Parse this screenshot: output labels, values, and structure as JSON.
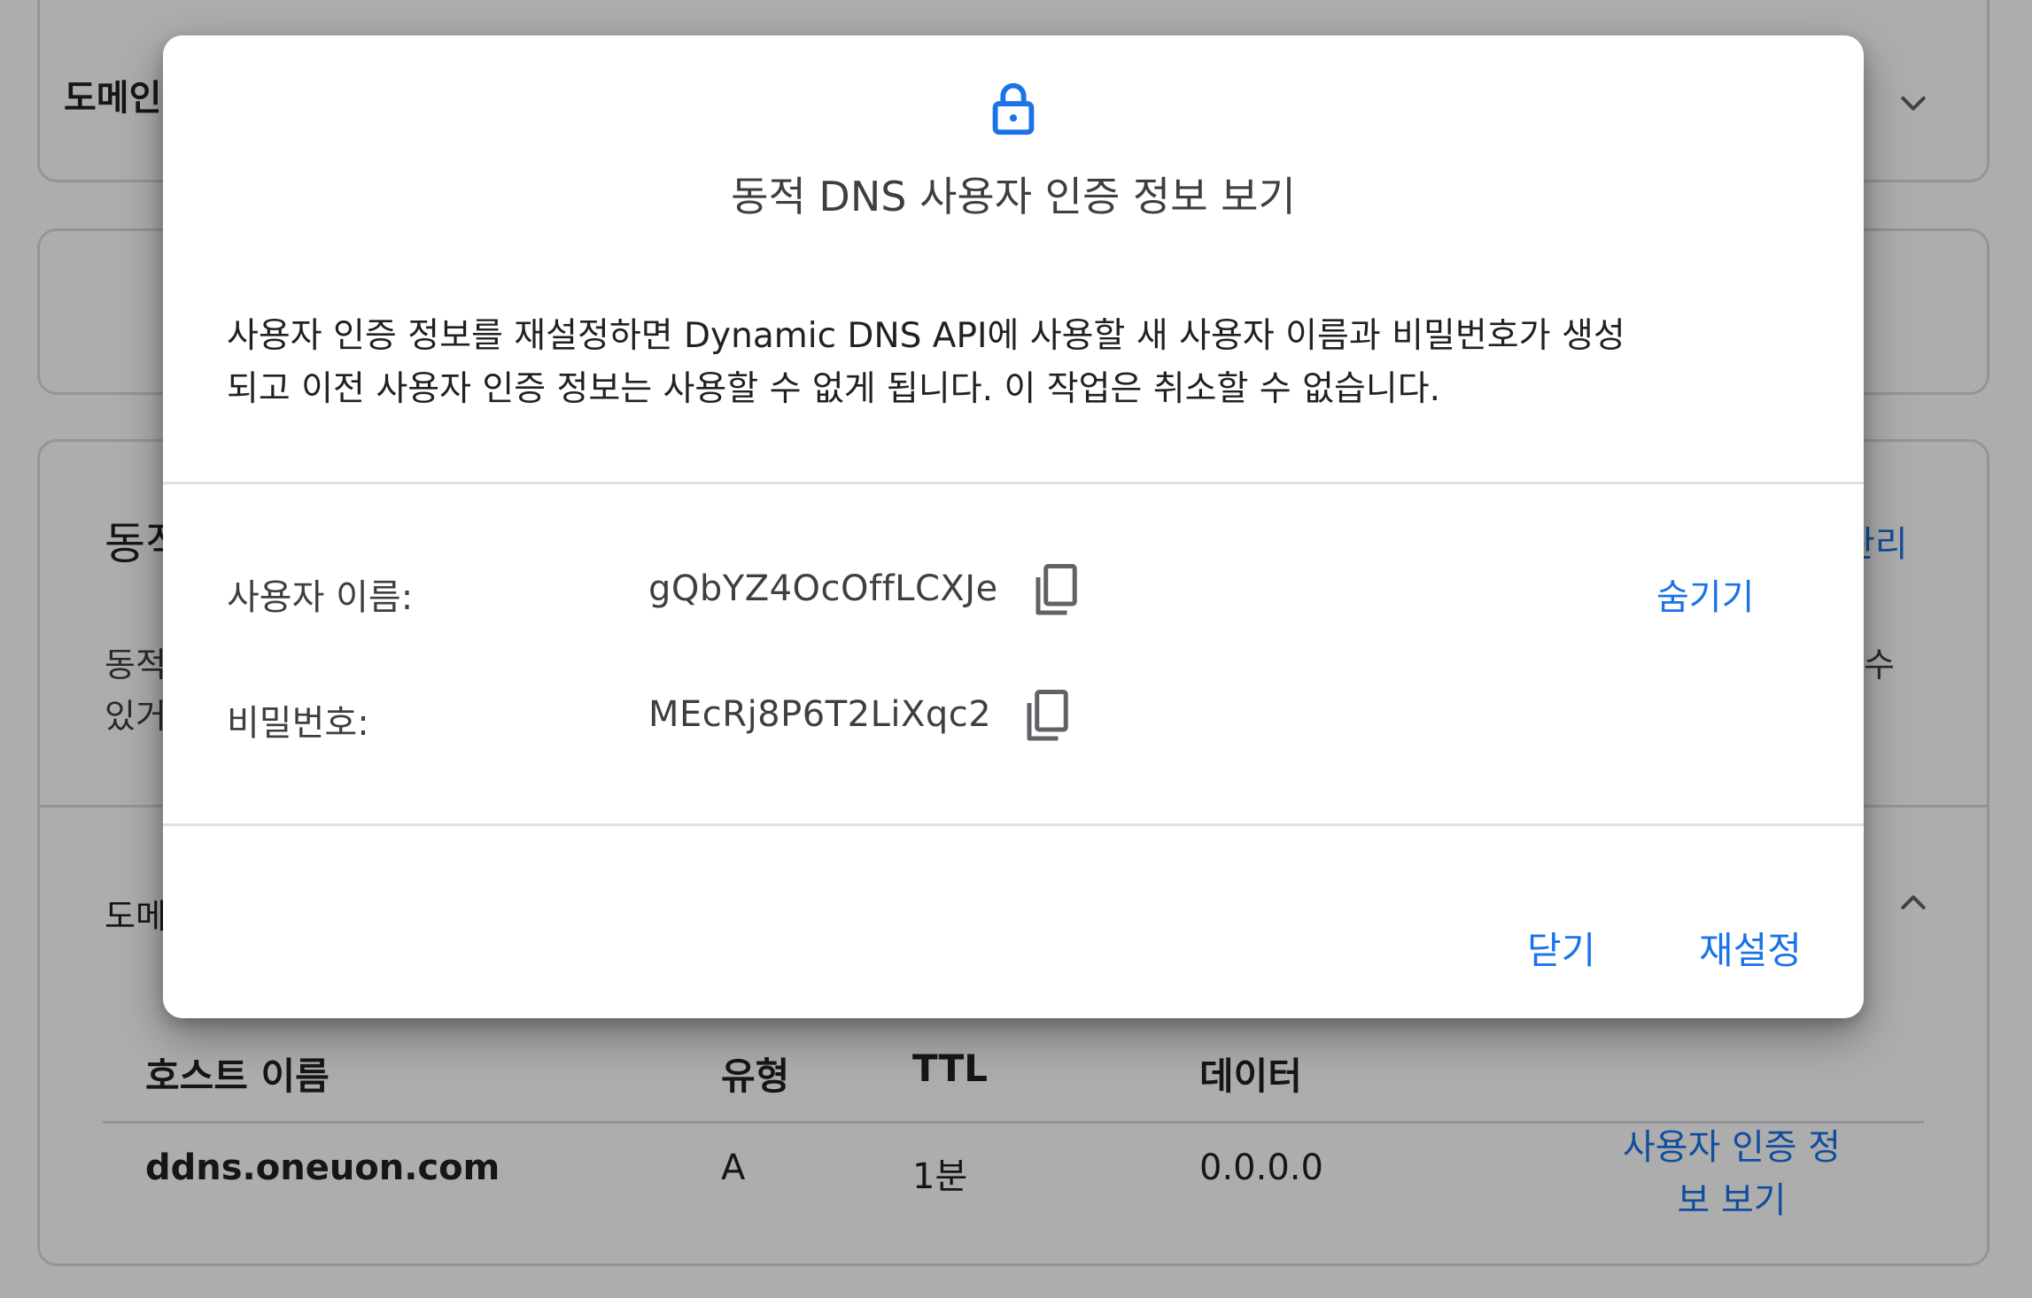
{
  "background": {
    "domain_section": {
      "heading": "도메인"
    },
    "ddns_section": {
      "title": "동적 DNS",
      "manage_link": "관리",
      "description_line1": "동적 DNS를 사용하면",
      "description_line2": "있거나",
      "description_right": "수",
      "domain_label": "도메인"
    },
    "table": {
      "headers": [
        "호스트 이름",
        "유형",
        "TTL",
        "데이터"
      ],
      "rows": [
        {
          "host": "ddns.oneuon.com",
          "type": "A",
          "ttl": "1분",
          "data": "0.0.0.0",
          "action_line1": "사용자 인증 정",
          "action_line2": "보 보기"
        }
      ]
    }
  },
  "dialog": {
    "icon": "lock-icon",
    "title": "동적 DNS 사용자 인증 정보 보기",
    "body_line1": "사용자 인증 정보를 재설정하면 Dynamic DNS API에 사용할 새 사용자 이름과 비밀번호가 생성",
    "body_line2": "되고 이전 사용자 인증 정보는 사용할 수 없게 됩니다. 이 작업은 취소할 수 없습니다.",
    "username_label": "사용자 이름:",
    "username_value": "gQbYZ4OcOffLCXJe",
    "password_label": "비밀번호:",
    "password_value": "MEcRj8P6T2LiXqc2",
    "hide_link": "숨기기",
    "close_button": "닫기",
    "reset_button": "재설정"
  },
  "colors": {
    "accent": "#1a73e8",
    "scrim": "rgba(0,0,0,0.32)",
    "icon_gray": "#5f6368"
  }
}
